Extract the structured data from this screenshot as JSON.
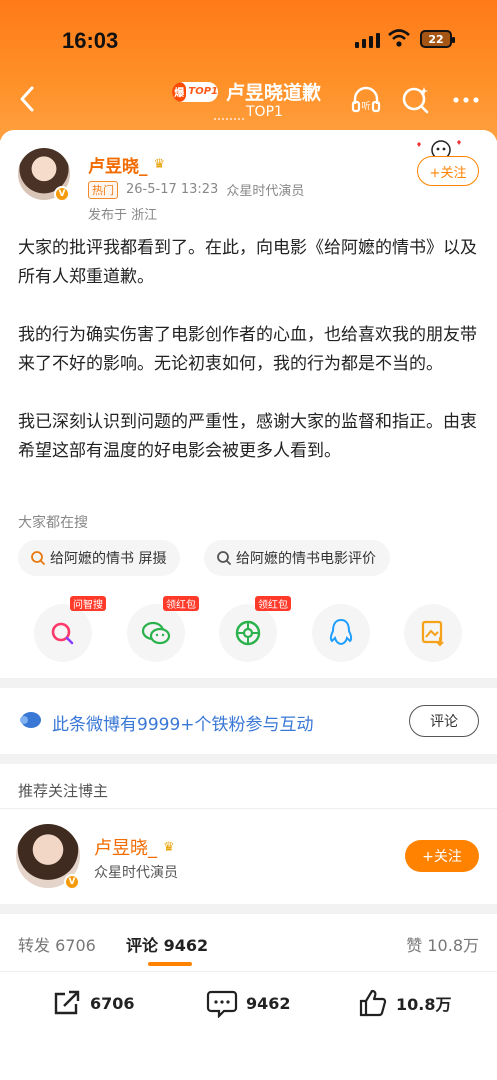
{
  "status_bar": {
    "time": "16:03",
    "battery": "22"
  },
  "nav": {
    "badge_left": "爆",
    "badge_right": "TOP1",
    "title": "卢昱晓道歉",
    "subtitle": "TOP1"
  },
  "post": {
    "author": "卢昱晓_",
    "hot_tag": "热门",
    "date": "26-5-17 13:23",
    "source": "众星时代演员",
    "location": "发布于 浙江",
    "follow_label": "+关注",
    "paragraphs": [
      "大家的批评我都看到了。在此，向电影《给阿嬷的情书》以及所有人郑重道歉。",
      "我的行为确实伤害了电影创作者的心血，也给喜欢我的朋友带来了不好的影响。无论初衷如何，我的行为都是不当的。",
      "我已深刻认识到问题的严重性，感谢大家的监督和指正。由衷希望这部有温度的好电影会被更多人看到。"
    ],
    "search_label": "大家都在搜",
    "search_chips": [
      "给阿嬷的情书 屏摄",
      "给阿嬷的情书电影评价"
    ],
    "share_tags": [
      "问智搜",
      "领红包",
      "领红包"
    ]
  },
  "fans_bar": {
    "text": "此条微博有9999+个铁粉参与互动",
    "button": "评论"
  },
  "recommend": {
    "title": "推荐关注博主",
    "name": "卢昱晓_",
    "desc": "众星时代演员",
    "follow_label": "+关注"
  },
  "tabs": {
    "repost": "转发 6706",
    "comment_label": "评论",
    "comment_count": "9462",
    "like": "赞 10.8万"
  },
  "bottom": {
    "repost": "6706",
    "comment": "9462",
    "like": "10.8万"
  },
  "colors": {
    "accent": "#ff8200",
    "link": "#3a78d6",
    "header": "#ff8f26"
  }
}
